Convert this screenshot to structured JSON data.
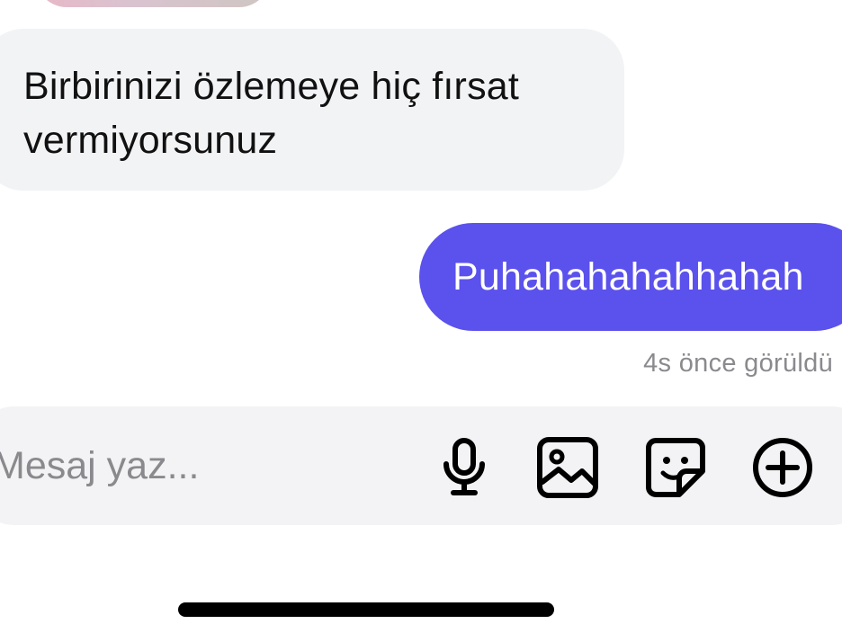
{
  "messages": {
    "incoming_text": "Birbirinizi özlemeye hiç fırsat vermiyorsunuz",
    "outgoing_text": "Puhahahahahhahah",
    "seen_status": "4s önce görüldü"
  },
  "composer": {
    "placeholder": "Mesaj yaz...",
    "value": ""
  },
  "icons": {
    "voice": "microphone-icon",
    "gallery": "image-icon",
    "sticker": "sticker-icon",
    "more": "plus-circle-icon"
  },
  "colors": {
    "outgoing_bubble": "#5b51ec",
    "incoming_bubble": "#f2f3f5",
    "composer_bg": "#f3f3f5",
    "muted_text": "#8a8a8e"
  }
}
